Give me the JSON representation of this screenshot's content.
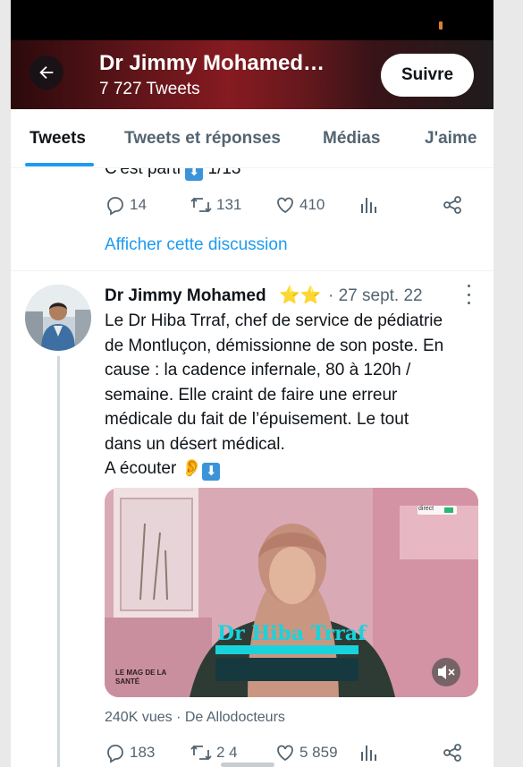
{
  "header": {
    "name": "Dr Jimmy Mohamed…",
    "tweet_count": "7 727 Tweets",
    "follow_label": "Suivre"
  },
  "tabs": [
    {
      "label": "Tweets",
      "active": true
    },
    {
      "label": "Tweets et réponses",
      "active": false
    },
    {
      "label": "Médias",
      "active": false
    },
    {
      "label": "J'aime",
      "active": false
    }
  ],
  "previous_tweet": {
    "partial_text": "C'est parti",
    "partial_suffix": "1/13",
    "replies": "14",
    "retweets": "131",
    "likes": "410",
    "show_thread": "Afficher cette discussion"
  },
  "tweet": {
    "author": "Dr Jimmy Mohamed",
    "badges": "⭐⭐",
    "date": "· 27 sept. 22",
    "body_lines": [
      "Le Dr Hiba Trraf, chef de service de pédiatrie",
      "de Montluçon, démissionne de son poste. En",
      "cause : la cadence infernale, 80 à 120h /",
      "semaine. Elle craint de faire une erreur",
      "médicale du fait de l’épuisement. Le tout",
      "dans un désert médical."
    ],
    "listen_text": "A écouter",
    "media": {
      "caption_name": "Dr Hiba Trraf",
      "show_logo": "LE MAG DE LA SANTÉ",
      "corner_tag": "direct"
    },
    "views": "240K vues",
    "source": "De Allodocteurs",
    "replies": "183",
    "retweets": "2 4",
    "likes": "5 859"
  },
  "colors": {
    "accent": "#1d9bf0",
    "muted": "#536471",
    "text": "#0f1419"
  },
  "icons": [
    "arrow-left-icon",
    "reply-icon",
    "retweet-icon",
    "like-icon",
    "stats-icon",
    "share-icon",
    "more-icon",
    "mute-icon"
  ]
}
